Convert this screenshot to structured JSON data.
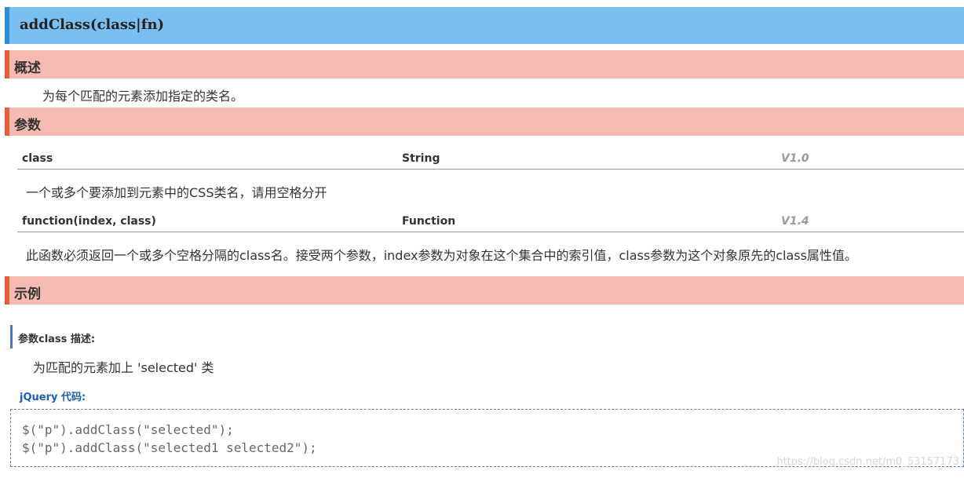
{
  "title": "addClass(class|fn)",
  "sections": {
    "overview": {
      "heading": "概述",
      "text": "为每个匹配的元素添加指定的类名。"
    },
    "params": {
      "heading": "参数",
      "items": [
        {
          "name": "class",
          "type": "String",
          "version": "V1.0",
          "description": "一个或多个要添加到元素中的CSS类名，请用空格分开"
        },
        {
          "name": "function(index, class)",
          "type": "Function",
          "version": "V1.4",
          "description": "此函数必须返回一个或多个空格分隔的class名。接受两个参数，index参数为对象在这个集合中的索引值，class参数为这个对象原先的class属性值。"
        }
      ]
    },
    "examples": {
      "heading": "示例",
      "label": "参数class 描述:",
      "description": "为匹配的元素加上 'selected' 类",
      "code_label": "jQuery 代码:",
      "code_lines": [
        "$(\"p\").addClass(\"selected\");",
        "$(\"p\").addClass(\"selected1 selected2\");"
      ]
    }
  },
  "watermark": "https://blog.csdn.net/m0_53157173"
}
